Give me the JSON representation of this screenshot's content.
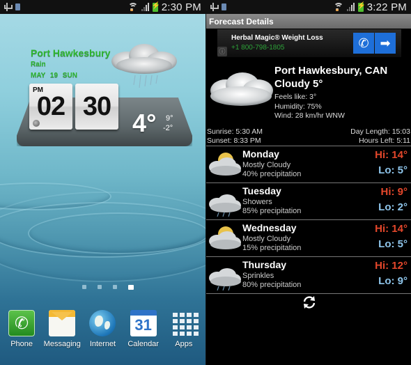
{
  "left_screen": {
    "status_bar": {
      "time": "2:30 PM",
      "icons": [
        "usb-icon",
        "sdcard-icon",
        "wifi-icon",
        "signal-icon",
        "battery-charging-icon"
      ]
    },
    "weather_widget": {
      "city": "Port Hawkesbury",
      "condition": "Rain",
      "date": "MAY  19  SUN",
      "clock_ampm": "PM",
      "clock_hours": "02",
      "clock_minutes": "30",
      "current_temp": "4°",
      "high": "9°",
      "low": "-2°"
    },
    "page_indicator": {
      "pages": 4,
      "active_page": 4
    },
    "dock": [
      {
        "label": "Phone",
        "icon": "phone-icon"
      },
      {
        "label": "Messaging",
        "icon": "messaging-icon"
      },
      {
        "label": "Internet",
        "icon": "globe-icon"
      },
      {
        "label": "Calendar",
        "icon": "calendar-icon"
      },
      {
        "label": "Apps",
        "icon": "apps-grid-icon"
      }
    ]
  },
  "right_screen": {
    "status_bar": {
      "time": "3:22 PM",
      "icons": [
        "usb-icon",
        "sdcard-icon",
        "wifi-icon",
        "signal-icon",
        "battery-charging-icon"
      ]
    },
    "title": "Forecast Details",
    "ad": {
      "title": "Herbal Magic® Weight Loss",
      "phone": "+1 800-798-1805",
      "call_icon": "phone-icon",
      "go_icon": "arrow-right-icon",
      "info_icon": "info-icon"
    },
    "current": {
      "location": "Port Hawkesbury, CAN",
      "condition": "Cloudy 5°",
      "feels_like": "Feels like: 3°",
      "humidity": "Humidity: 75%",
      "wind": "Wind: 28 km/hr WNW",
      "sunrise": "Sunrise: 5:30 AM",
      "sunset": "Sunset: 8:33 PM",
      "day_length": "Day Length: 15:03",
      "hours_left": "Hours Left: 5:11"
    },
    "forecast": [
      {
        "day": "Monday",
        "condition": "Mostly Cloudy",
        "precip": "40% precipitation",
        "hi": "Hi: 14°",
        "lo": "Lo: 5°",
        "icon": "mostly-cloudy-icon"
      },
      {
        "day": "Tuesday",
        "condition": "Showers",
        "precip": "85% precipitation",
        "hi": "Hi: 9°",
        "lo": "Lo: 2°",
        "icon": "showers-icon"
      },
      {
        "day": "Wednesday",
        "condition": "Mostly Cloudy",
        "precip": "15% precipitation",
        "hi": "Hi: 14°",
        "lo": "Lo: 5°",
        "icon": "mostly-cloudy-icon"
      },
      {
        "day": "Thursday",
        "condition": "Sprinkles",
        "precip": "80% precipitation",
        "hi": "Hi: 12°",
        "lo": "Lo: 9°",
        "icon": "sprinkles-icon"
      }
    ],
    "refresh_icon": "refresh-icon",
    "colors": {
      "hi": "#e4472b",
      "lo": "#8fc6ec",
      "ad_button": "#1e6fd9",
      "widget_text": "#2db52d"
    }
  }
}
